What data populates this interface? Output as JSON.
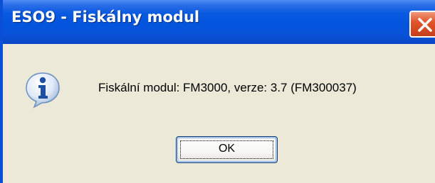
{
  "window": {
    "title": "ESO9 - Fiskálny modul"
  },
  "titlebar": {
    "close_icon": "close-icon"
  },
  "dialog": {
    "icon": "information-icon",
    "message": "Fiskální modul: FM3000, verze: 3.7  (FM300037)",
    "ok_label": "OK"
  },
  "colors": {
    "titlebar": "#0354de",
    "close_button": "#d64a22",
    "dialog_background": "#ece9d8"
  }
}
